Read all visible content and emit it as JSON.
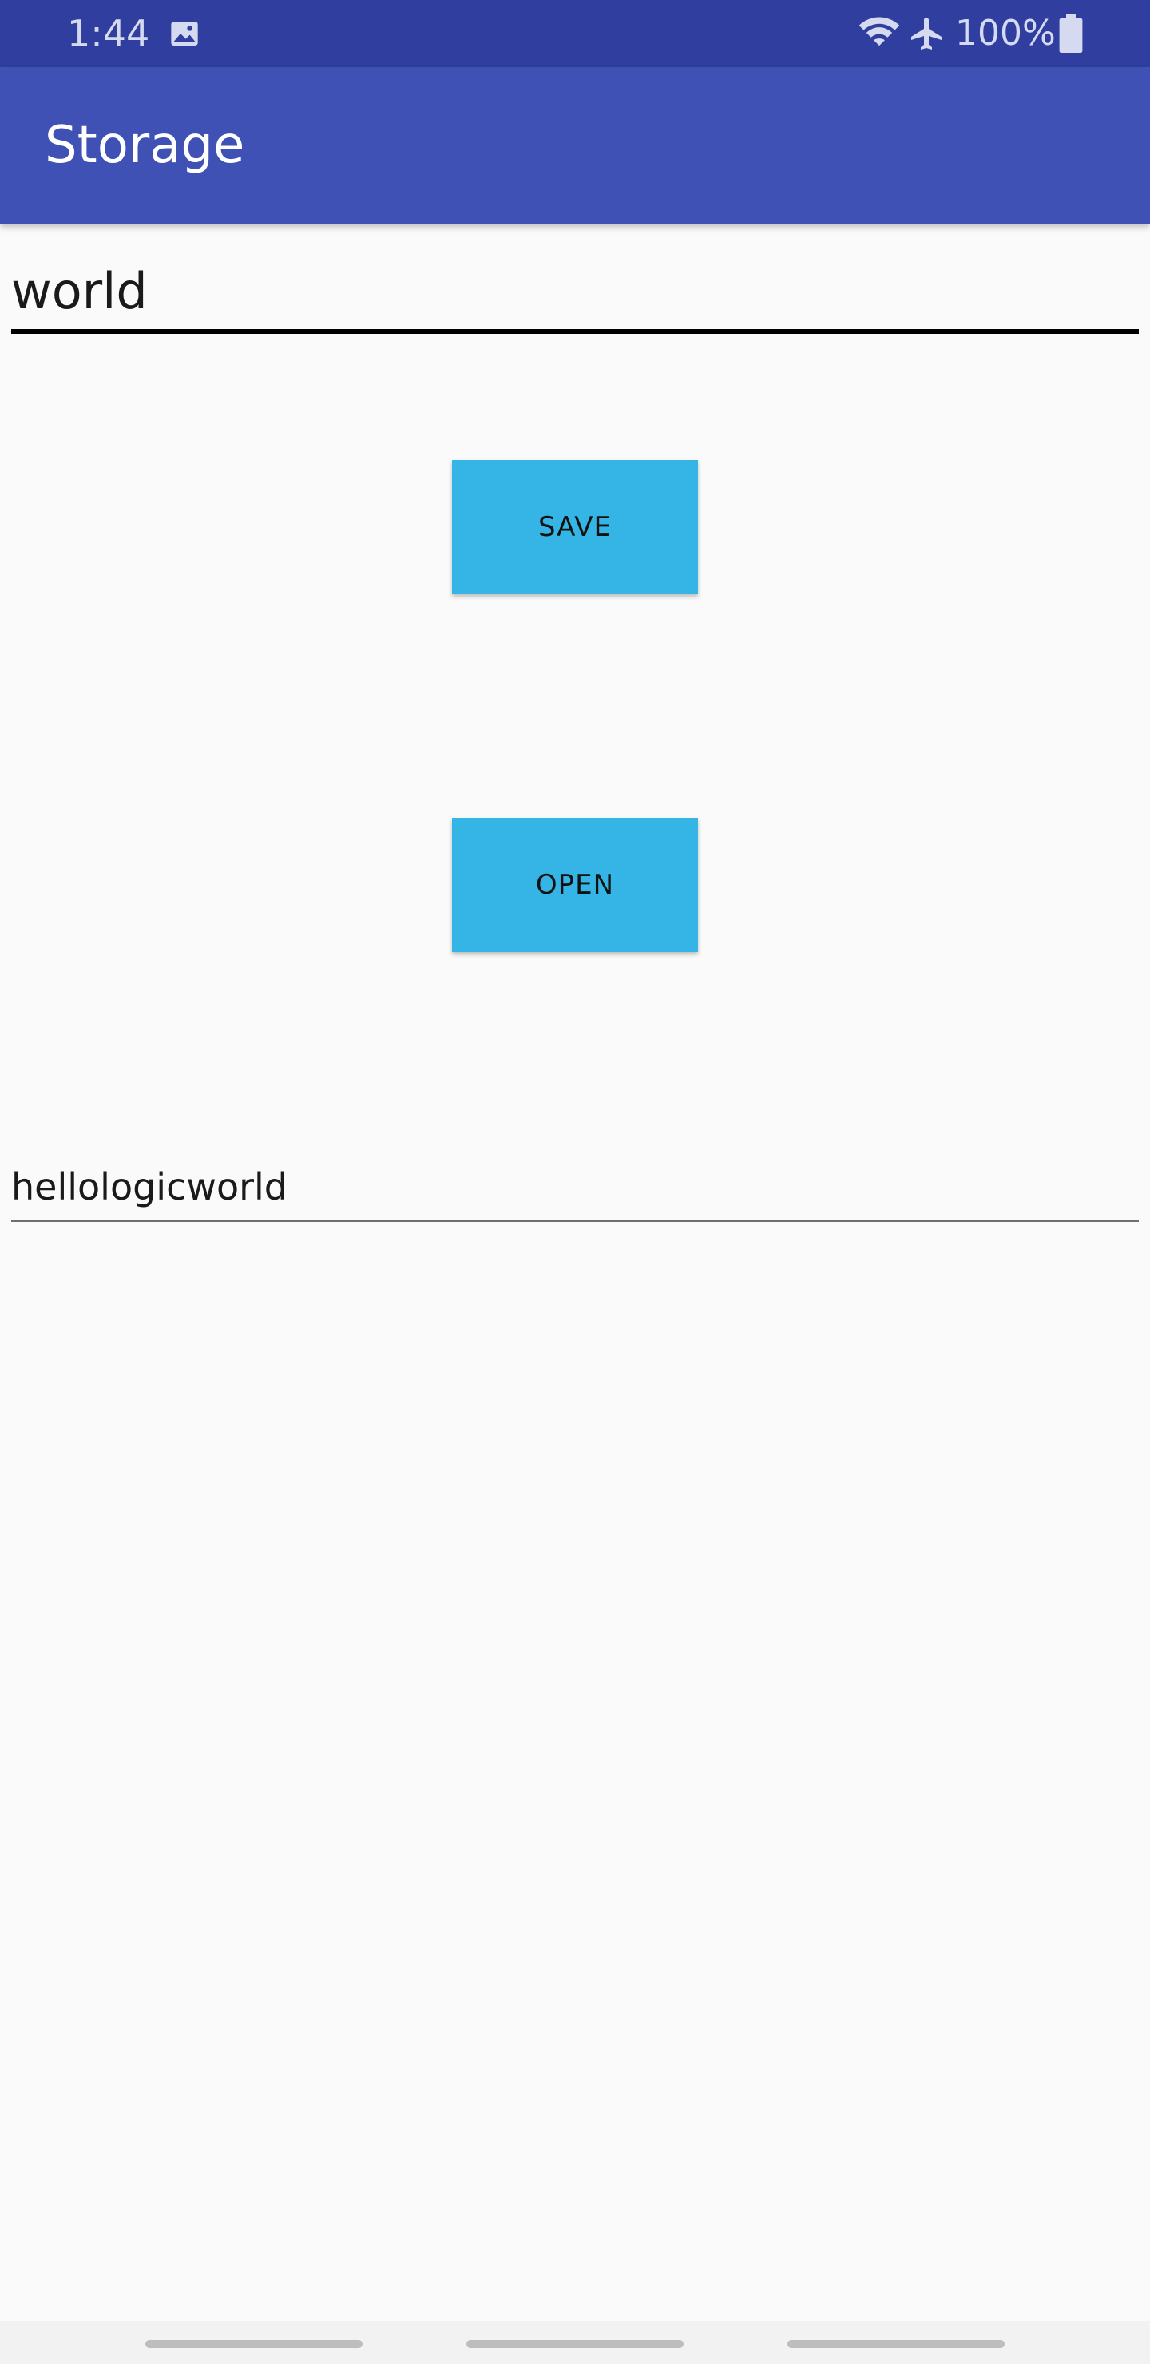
{
  "status_bar": {
    "time": "1:44",
    "battery": "100%",
    "icons": [
      "image-icon",
      "wifi-icon",
      "airplane-icon",
      "battery-icon"
    ]
  },
  "app_bar": {
    "title": "Storage"
  },
  "input_top": {
    "value": "world"
  },
  "buttons": {
    "save": "SAVE",
    "open": "OPEN"
  },
  "input_bottom": {
    "value": "hellologicworld"
  },
  "colors": {
    "status_bar": "#303F9F",
    "app_bar": "#3F51B5",
    "button": "#35B5E5",
    "background": "#FAFAFA"
  }
}
